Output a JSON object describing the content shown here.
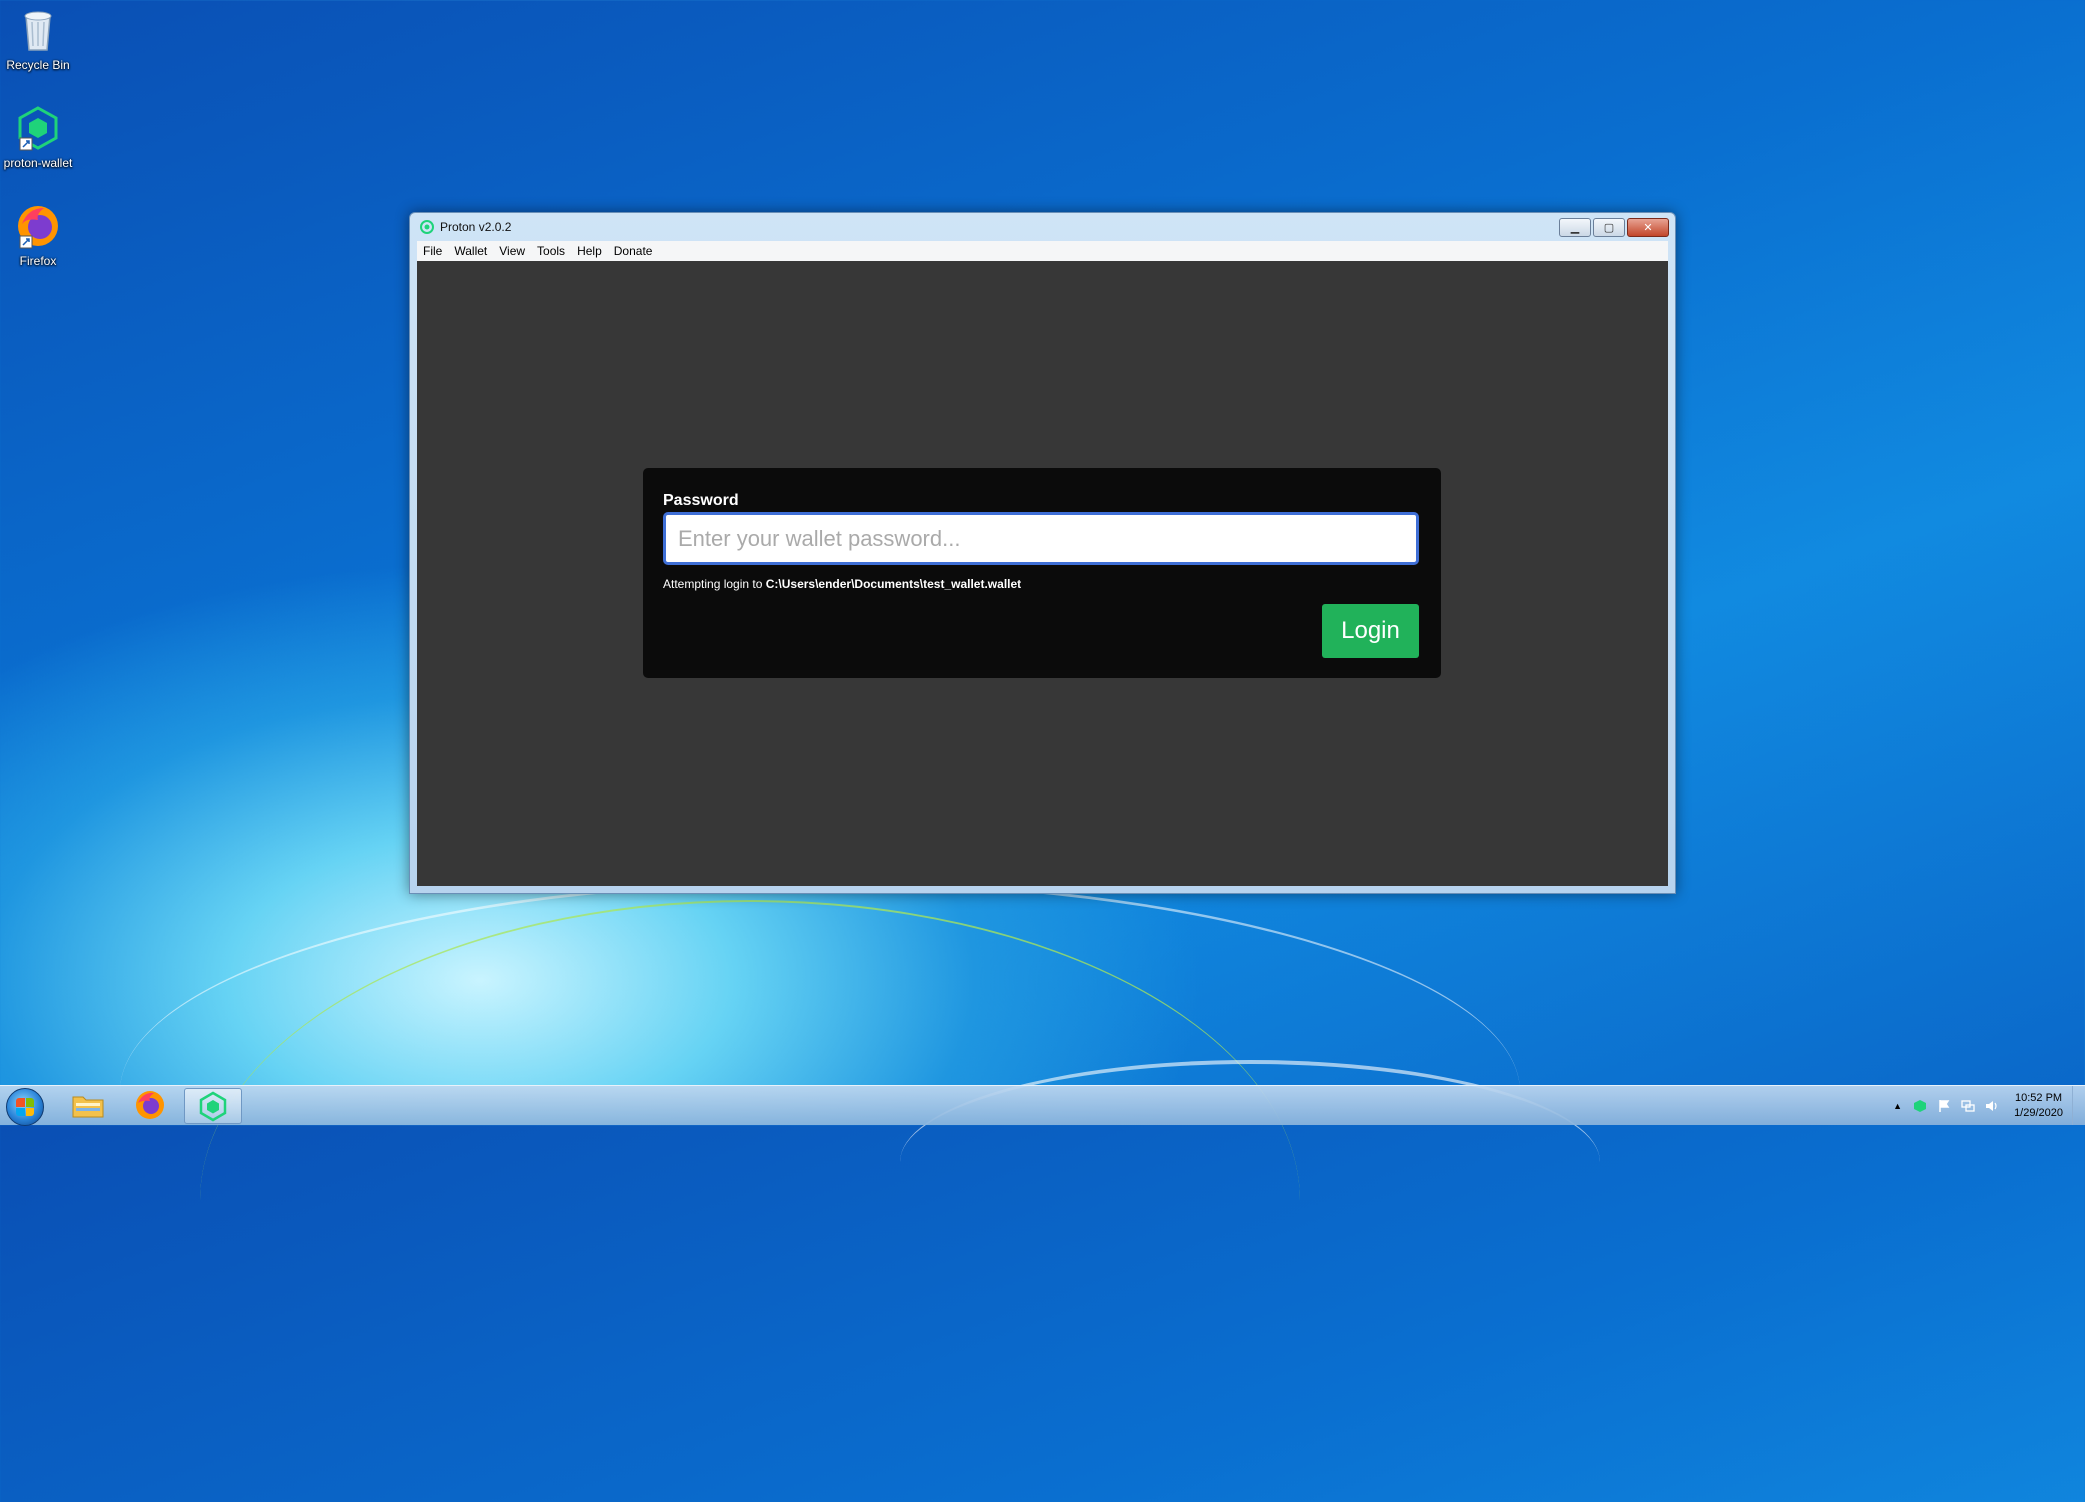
{
  "desktop": {
    "icons": [
      {
        "label": "Recycle Bin"
      },
      {
        "label": "proton-wallet"
      },
      {
        "label": "Firefox"
      }
    ]
  },
  "window": {
    "title": "Proton v2.0.2",
    "menu": [
      "File",
      "Wallet",
      "View",
      "Tools",
      "Help",
      "Donate"
    ],
    "controls": {
      "minimize": "▁",
      "maximize": "▢",
      "close": "✕"
    }
  },
  "login": {
    "password_label": "Password",
    "password_placeholder": "Enter your wallet password...",
    "password_value": "",
    "hint_prefix": "Attempting login to ",
    "wallet_path": "C:\\Users\\ender\\Documents\\test_wallet.wallet",
    "login_button": "Login",
    "accent_color": "#21b25a",
    "focus_color": "#3f6fd6"
  },
  "taskbar": {
    "apps": [
      {
        "name": "windows-explorer-icon"
      },
      {
        "name": "firefox-icon"
      },
      {
        "name": "proton-wallet-icon",
        "active": true
      }
    ],
    "tray": {
      "chevron": "▲",
      "time": "10:52 PM",
      "date": "1/29/2020"
    }
  }
}
